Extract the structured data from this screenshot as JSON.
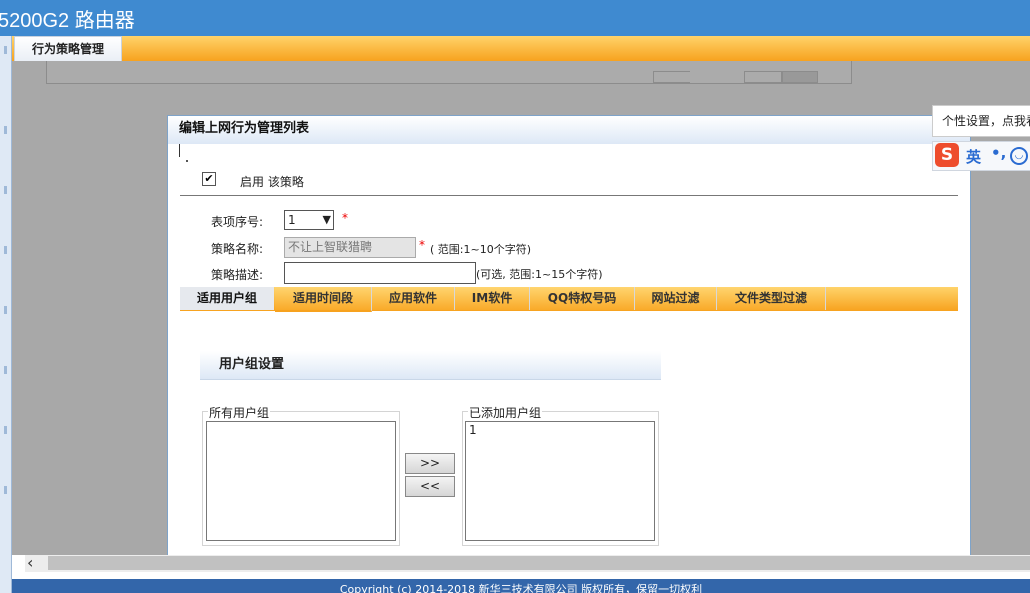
{
  "app": {
    "title": "5200G2 路由器"
  },
  "main_tab": {
    "label": "行为策略管理"
  },
  "dialog": {
    "title": "编辑上网行为管理列表",
    "enable": {
      "checked": true,
      "label": "启用 该策略"
    },
    "fields": {
      "index": {
        "label": "表项序号:",
        "value": "1",
        "required_mark": "*"
      },
      "name": {
        "label": "策略名称:",
        "value": "不让上智联猎聘",
        "required_mark": "*",
        "hint": "( 范围:1~10个字符)"
      },
      "desc": {
        "label": "策略描述:",
        "value": "",
        "hint": "(可选, 范围:1~15个字符)"
      }
    },
    "tabs": [
      "适用用户组",
      "适用时间段",
      "应用软件",
      "IM软件",
      "QQ特权号码",
      "网站过滤",
      "文件类型过滤"
    ],
    "active_tab": "适用用户组",
    "user_group_panel": {
      "title": "用户组设置",
      "all_groups": {
        "legend": "所有用户组",
        "items": []
      },
      "added_groups": {
        "legend": "已添加用户组",
        "items": [
          "1"
        ]
      },
      "add_button": ">>",
      "remove_button": "<<"
    }
  },
  "footer": {
    "text": "Copyright (c) 2014-2018 新华三技术有限公司 版权所有，保留一切权利"
  },
  "ime": {
    "tooltip": "个性设置，点我看",
    "logo": "S",
    "mode": "英",
    "punct": "•,",
    "emoji_icon": "smile-icon"
  },
  "colors": {
    "header": "#3f8ad0",
    "tab_orange": "#f7a21e",
    "required": "#ee0000",
    "footer": "#3366aa"
  }
}
